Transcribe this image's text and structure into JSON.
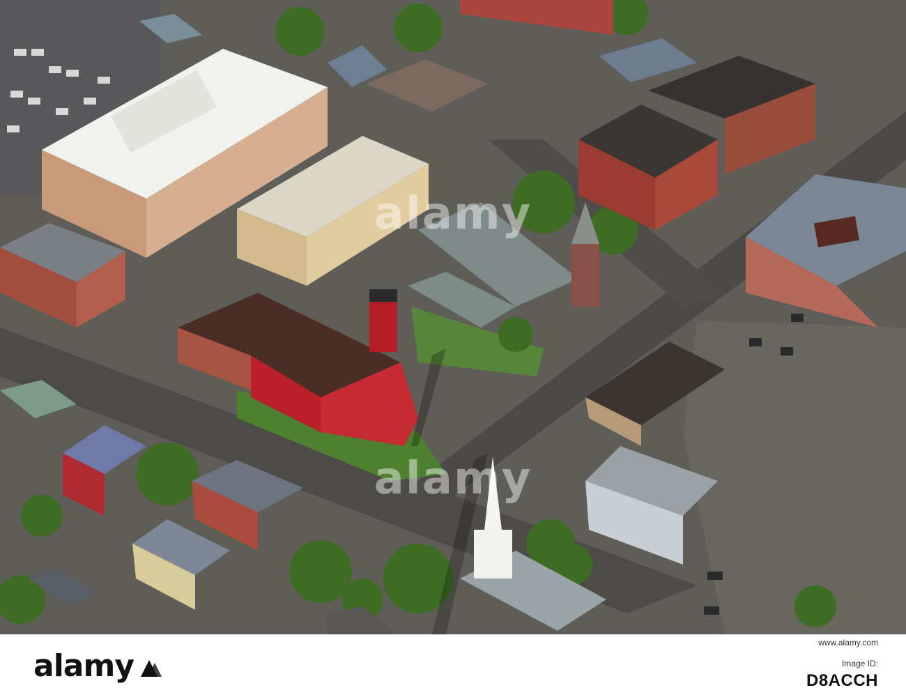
{
  "watermark": {
    "text": "alamy"
  },
  "footer": {
    "logo_text": "alamy",
    "site_url": "www.alamy.com",
    "image_id_label": "Image ID:",
    "image_id": "D8ACCH"
  },
  "photo": {
    "palette": {
      "asphalt": "#55544f",
      "lawn": "#4a7a2c",
      "tree": "#3f6e24",
      "red_building": "#b8202c",
      "brick": "#9a4e3f",
      "white_roof": "#f2f2ee",
      "tan_building": "#d9c6a0",
      "dark_roof": "#2f2c2a",
      "church_roof": "#7d8a8a"
    }
  }
}
